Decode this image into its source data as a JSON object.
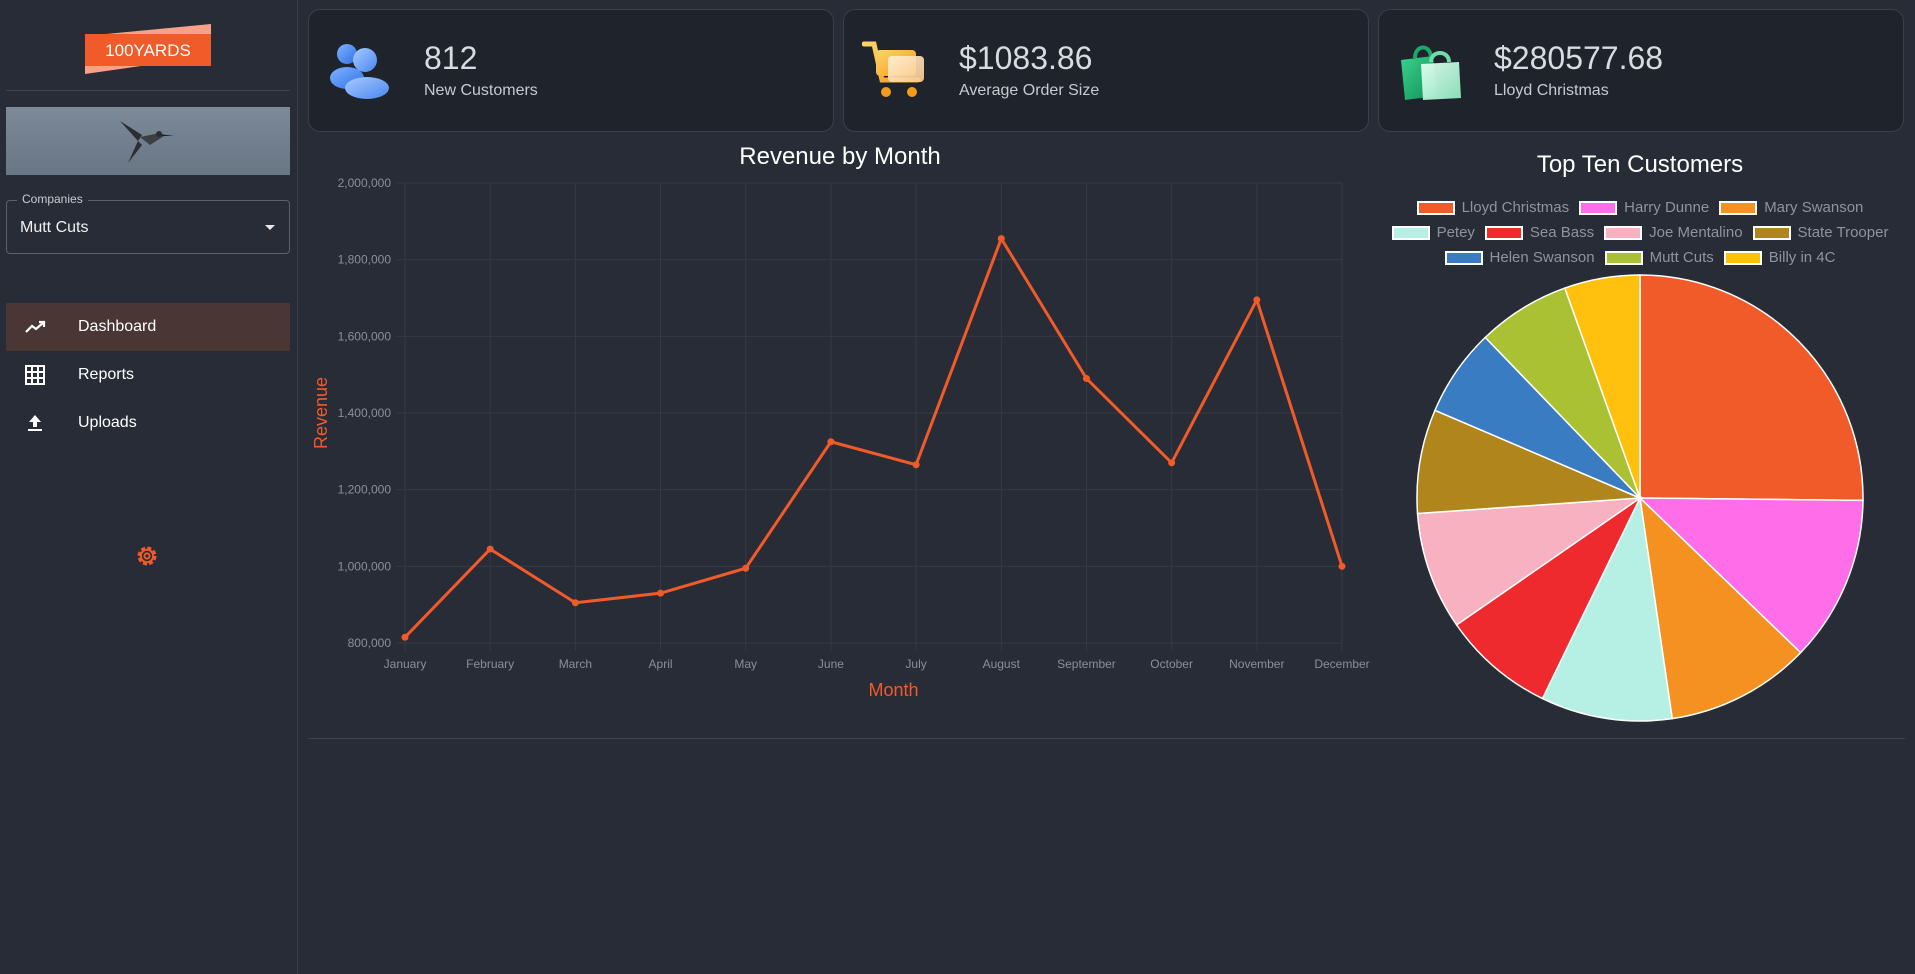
{
  "brand": {
    "logo_text": "100YARDS",
    "accent": "#f15a29"
  },
  "sidebar": {
    "company_select": {
      "legend": "Companies",
      "value": "Mutt Cuts"
    },
    "nav": [
      {
        "label": "Dashboard",
        "icon": "trending-up-icon",
        "active": true
      },
      {
        "label": "Reports",
        "icon": "grid-icon",
        "active": false
      },
      {
        "label": "Uploads",
        "icon": "upload-icon",
        "active": false
      }
    ],
    "settings_icon": "settings-icon"
  },
  "cards": [
    {
      "value": "812",
      "label": "New Customers",
      "icon": "customers-icon"
    },
    {
      "value": "$1083.86",
      "label": "Average Order Size",
      "icon": "cart-icon"
    },
    {
      "value": "$280577.68",
      "label": "Lloyd Christmas",
      "icon": "shopping-bag-icon"
    }
  ],
  "chart_data": [
    {
      "type": "line",
      "title": "Revenue by Month",
      "xlabel": "Month",
      "ylabel": "Revenue",
      "ylim": [
        800000,
        2000000
      ],
      "yticks": [
        "800,000",
        "1,000,000",
        "1,200,000",
        "1,400,000",
        "1,600,000",
        "1,800,000",
        "2,000,000"
      ],
      "grid": true,
      "color": "#f15a29",
      "categories": [
        "January",
        "February",
        "March",
        "April",
        "May",
        "June",
        "July",
        "August",
        "September",
        "October",
        "November",
        "December"
      ],
      "values": [
        815000,
        1045000,
        905000,
        930000,
        995000,
        1325000,
        1265000,
        1855000,
        1490000,
        1270000,
        1695000,
        1000000
      ]
    },
    {
      "type": "pie",
      "title": "Top Ten Customers",
      "legend_position": "top",
      "categories": [
        "Lloyd Christmas",
        "Harry Dunne",
        "Mary Swanson",
        "Petey",
        "Sea Bass",
        "Joe Mentalino",
        "State Trooper",
        "Helen Swanson",
        "Mutt Cuts",
        "Billy in 4C"
      ],
      "colors": [
        "#f15a29",
        "#ff6de8",
        "#f59121",
        "#b6f0e4",
        "#ee2a2f",
        "#f7b1c1",
        "#b0861c",
        "#3a7cc2",
        "#aac133",
        "#ffc10e"
      ],
      "values": [
        280577.68,
        134000,
        117000,
        106000,
        91000,
        95000,
        84000,
        71000,
        75000,
        61000
      ]
    }
  ]
}
